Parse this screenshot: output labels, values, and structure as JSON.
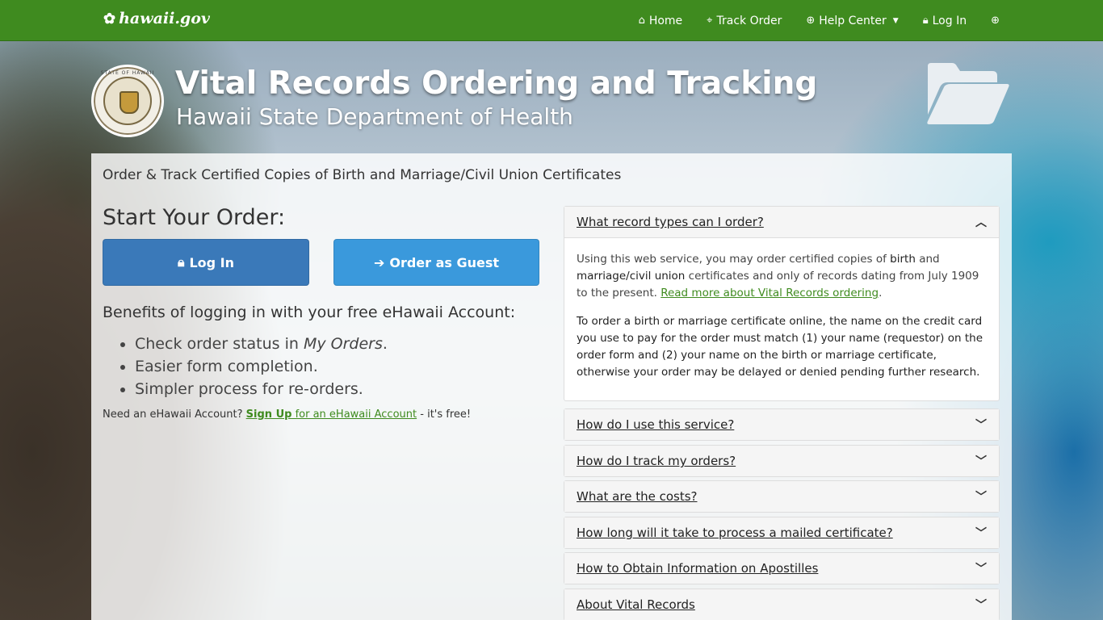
{
  "header": {
    "logo_text": "hawaii.gov",
    "nav": {
      "home": "Home",
      "track": "Track Order",
      "help": "Help Center",
      "login": "Log In"
    }
  },
  "hero": {
    "seal_text": "STATE OF HAWAII",
    "title": "Vital Records Ordering and Tracking",
    "subtitle": "Hawaii State Department of Health"
  },
  "main": {
    "heading": "Order & Track Certified Copies of Birth and Marriage/Civil Union Certificates",
    "start_title": "Start Your Order:",
    "login_button": "Log In",
    "guest_button": "Order as Guest",
    "benefits_title": "Benefits of logging in with your free eHawaii Account:",
    "benefits": {
      "item1_pre": "Check order status in ",
      "item1_em": "My Orders",
      "item1_post": ".",
      "item2": "Easier form completion.",
      "item3": "Simpler process for re-orders."
    },
    "signup": {
      "pre": "Need an eHawaii Account? ",
      "link_bold": "Sign Up",
      "link_rest": " for an eHawaii Account",
      "post": " - it's free!"
    }
  },
  "faq": {
    "open": {
      "title": "What record types can I order?",
      "p1_a": "Using this web service, you may order certified copies of ",
      "p1_birth": "birth",
      "p1_b": " and ",
      "p1_marriage": "marriage/civil union",
      "p1_c": " certificates and only of records dating from July 1909 to the present. ",
      "p1_link": "Read more about Vital Records ordering",
      "p1_end": ".",
      "p2": "To order a birth or marriage certificate online, the name on the credit card you use to pay for the order must match (1) your name (requestor) on the order form and (2) your name on the birth or marriage certificate, otherwise your order may be delayed or denied pending further research."
    },
    "items": [
      "How do I use this service?",
      "How do I track my orders?",
      "What are the costs?",
      "How long will it take to process a mailed certificate?",
      "How to Obtain Information on Apostilles",
      "About Vital Records"
    ]
  },
  "colors": {
    "topbar": "#3f8b1f",
    "login_button": "#3a79b9",
    "guest_button": "#3a99dc",
    "link": "#3f8b1f"
  },
  "icons": {
    "logo": "hibiscus-icon",
    "home": "home-icon",
    "track": "crosshair-icon",
    "help": "lifebuoy-icon",
    "login": "lock-icon",
    "extra": "plus-circle-icon",
    "folder": "folder-open-icon",
    "guest": "sign-in-icon",
    "chevron": "chevron-icon"
  }
}
